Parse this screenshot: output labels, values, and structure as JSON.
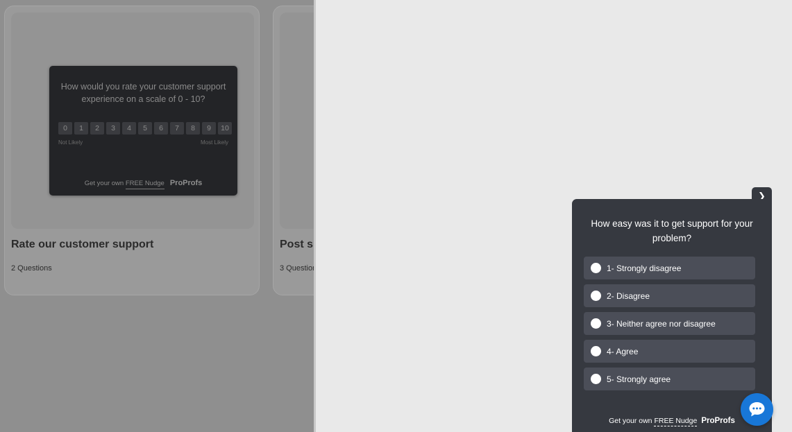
{
  "cards": [
    {
      "title": "Rate our customer support",
      "meta": "2 Questions",
      "preview": {
        "question": "How would you rate your customer support experience on a scale of 0 - 10?",
        "scale": [
          "0",
          "1",
          "2",
          "3",
          "4",
          "5",
          "6",
          "7",
          "8",
          "9",
          "10"
        ],
        "low_label": "Not Likely",
        "high_label": "Most Likely",
        "footer_prefix": "Get your own ",
        "footer_link": "FREE Nudge",
        "brand": "ProProfs"
      }
    },
    {
      "title": "Post su",
      "meta": "3 Question"
    }
  ],
  "survey": {
    "collapse_icon": "chevron-down-icon",
    "question": "How easy was it to get support for your problem?",
    "options": [
      "1- Strongly disagree",
      "2- Disagree",
      "3- Neither agree nor disagree",
      "4- Agree",
      "5- Strongly agree"
    ],
    "footer_prefix": "Get your own ",
    "footer_link": "FREE Nudge",
    "brand": "ProProfs"
  },
  "chat": {
    "icon": "chat-bubble-icon",
    "color": "#1877d8"
  },
  "colors": {
    "overlay": "#8f8f8f",
    "popup": "#363940",
    "option": "#4b4e58",
    "nps_bg": "#232427"
  }
}
